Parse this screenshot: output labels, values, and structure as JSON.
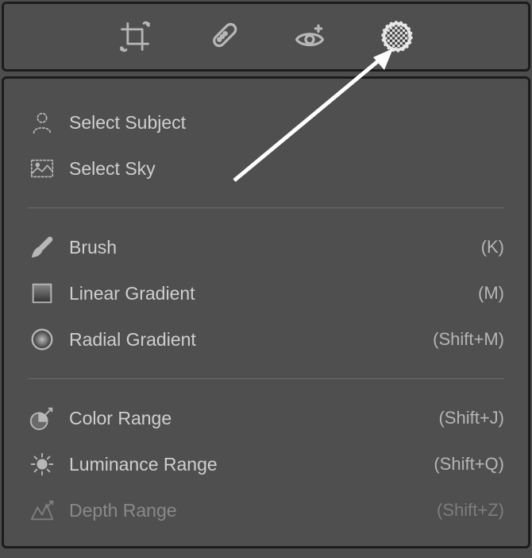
{
  "toolbar": {
    "tools": [
      {
        "id": "crop"
      },
      {
        "id": "heal"
      },
      {
        "id": "redeye"
      },
      {
        "id": "masking"
      }
    ]
  },
  "menu": {
    "sections": [
      {
        "items": [
          {
            "icon": "subject",
            "label": "Select Subject",
            "shortcut": ""
          },
          {
            "icon": "sky",
            "label": "Select Sky",
            "shortcut": ""
          }
        ]
      },
      {
        "items": [
          {
            "icon": "brush",
            "label": "Brush",
            "shortcut": "(K)"
          },
          {
            "icon": "lineargradient",
            "label": "Linear Gradient",
            "shortcut": "(M)"
          },
          {
            "icon": "radialgradient",
            "label": "Radial Gradient",
            "shortcut": "(Shift+M)"
          }
        ]
      },
      {
        "items": [
          {
            "icon": "colorrange",
            "label": "Color Range",
            "shortcut": "(Shift+J)"
          },
          {
            "icon": "luminance",
            "label": "Luminance Range",
            "shortcut": "(Shift+Q)"
          },
          {
            "icon": "depth",
            "label": "Depth Range",
            "shortcut": "(Shift+Z)",
            "disabled": true
          }
        ]
      }
    ]
  }
}
